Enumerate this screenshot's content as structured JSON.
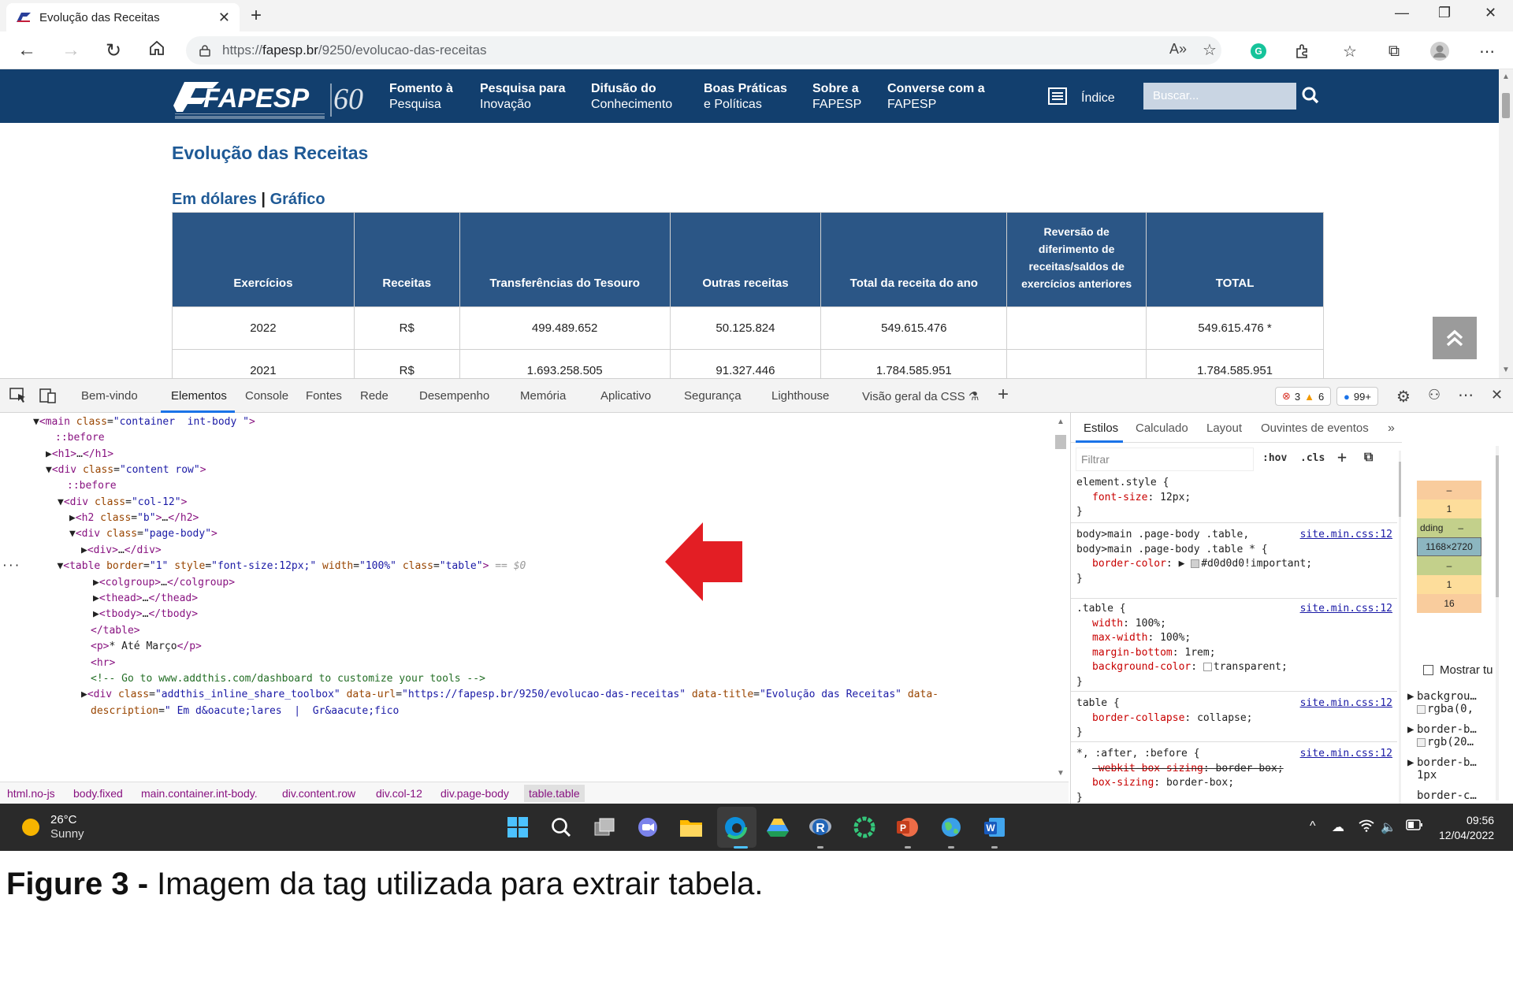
{
  "browser": {
    "tab_title": "Evolução das Receitas",
    "url_scheme": "https://",
    "url_host": "fapesp.br",
    "url_path": "/9250/evolucao-das-receitas"
  },
  "site": {
    "nav": [
      {
        "line1": "Fomento à",
        "line2": "Pesquisa"
      },
      {
        "line1": "Pesquisa para",
        "line2": "Inovação"
      },
      {
        "line1": "Difusão do",
        "line2": "Conhecimento"
      },
      {
        "line1": "Boas Práticas",
        "line2": "e Políticas"
      },
      {
        "line1": "Sobre a",
        "line2": "FAPESP"
      },
      {
        "line1": "Converse com a",
        "line2": "FAPESP"
      }
    ],
    "indice_label": "Índice",
    "search_placeholder": "Buscar...",
    "page_title": "Evolução das Receitas",
    "subtitle_link1": "Em dólares",
    "subtitle_sep": "|",
    "subtitle_link2": "Gráfico",
    "table": {
      "headers": [
        "Exercícios",
        "Receitas",
        "Transferências do Tesouro",
        "Outras receitas",
        "Total da receita do ano",
        "Reversão de diferimento de receitas/saldos de exercícios anteriores",
        "TOTAL"
      ],
      "rows": [
        [
          "2022",
          "R$",
          "499.489.652",
          "50.125.824",
          "549.615.476",
          "",
          "549.615.476 *"
        ],
        [
          "2021",
          "R$",
          "1.693.258.505",
          "91.327.446",
          "1.784.585.951",
          "",
          "1.784.585.951"
        ]
      ]
    }
  },
  "devtools": {
    "tabs": [
      "Bem-vindo",
      "Elementos",
      "Console",
      "Fontes",
      "Rede",
      "Desempenho",
      "Memória",
      "Aplicativo",
      "Segurança",
      "Lighthouse",
      "Visão geral da CSS"
    ],
    "active_tab": "Elementos",
    "errors": "3",
    "warnings": "6",
    "messages": "99+",
    "styles_tabs": [
      "Estilos",
      "Calculado",
      "Layout",
      "Ouvintes de eventos"
    ],
    "filter_placeholder": "Filtrar",
    "hov": ":hov",
    "cls": ".cls",
    "breadcrumbs": [
      "html.no-js",
      "body.fixed",
      "main.container.int-body.",
      "div.content.row",
      "div.col-12",
      "div.page-body",
      "table.table"
    ],
    "box_model": {
      "dash1": "–",
      "val1": "1",
      "padding_label": "dding",
      "dash2": "–",
      "content": "1168×2720",
      "dash3": "–",
      "val2": "1",
      "val3": "16"
    },
    "show_all_label": "Mostrar tu",
    "computed": [
      {
        "name": "backgrou…",
        "value": "rgba(0,"
      },
      {
        "name": "border-b…",
        "value": "rgb(20…"
      },
      {
        "name": "border-b…",
        "value": "1px"
      },
      {
        "name": "border-c…",
        "value": ""
      }
    ]
  },
  "taskbar": {
    "temp": "26°C",
    "weather": "Sunny",
    "time": "09:56",
    "date": "12/04/2022"
  },
  "caption": {
    "bold": "Figure 3 -",
    "text": " Imagem da tag utilizada para extrair tabela."
  }
}
